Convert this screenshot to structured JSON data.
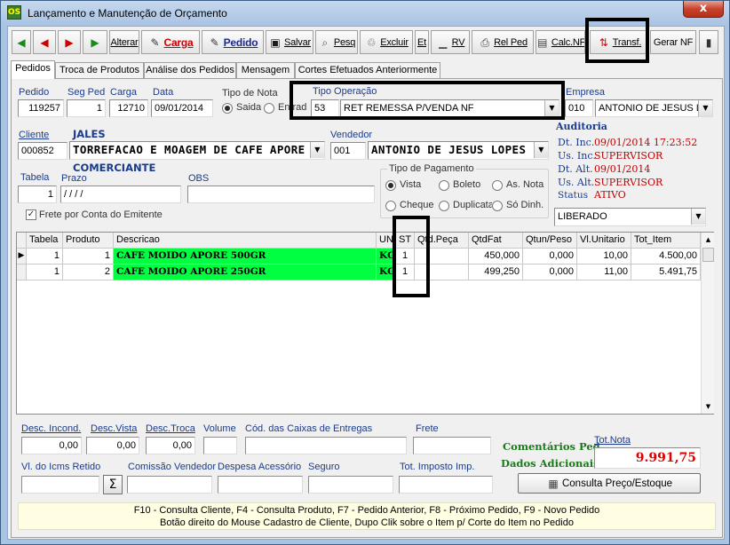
{
  "window": {
    "title": "Lançamento e Manutenção de Orçamento",
    "close_label": "x",
    "icon_label": "OS"
  },
  "toolbar": {
    "alterar": "Alterar",
    "carga_bold": "Carga",
    "pedido_bold": "Pedido",
    "salvar": "Salvar",
    "pesq": "Pesq",
    "excluir": "Excluir",
    "et": "Et",
    "rv": "RV",
    "relped": "Rel Ped",
    "calcnf": "Calc.NF",
    "transf": "Transf.",
    "gerarnf": "Gerar NF"
  },
  "tabs": [
    "Pedidos",
    "Troca de Produtos",
    "Análise dos Pedidos",
    "Mensagem",
    "Cortes Efetuados Anteriormente"
  ],
  "header": {
    "pedido_label": "Pedido",
    "pedido": "119257",
    "segped_label": "Seg Ped",
    "segped": "1",
    "carga_label": "Carga",
    "carga": "12710",
    "data_label": "Data",
    "data": "09/01/2014",
    "tiponota_label": "Tipo de Nota",
    "saida_label": "Saida",
    "entrada_label": "Entrad",
    "tipooperacao_label": "Tipo Operação",
    "tipooperacao_code": "53",
    "tipooperacao_desc": "RET REMESSA P/VENDA NF",
    "empresa_label": "Empresa",
    "empresa_code": "010",
    "empresa_name": "ANTONIO DE JESUS LO",
    "cliente_label": "Cliente",
    "cliente_code": "000852",
    "cliente_city": "JALES",
    "cliente_name": "TORREFACAO E MOAGEM DE CAFE APORE L",
    "cliente_type": "COMERCIANTE",
    "vendedor_label": "Vendedor",
    "vendedor_code": "001",
    "vendedor_name": "ANTONIO DE JESUS LOPES",
    "tabela_label": "Tabela",
    "tabela": "1",
    "prazo_label": "Prazo",
    "prazo": " / / / /",
    "obs_label": "OBS",
    "obs": "",
    "frete_label": "Frete por Conta  do Emitente",
    "tipopag_label": "Tipo de Pagamento",
    "pag_vista": "Vista",
    "pag_boleto": "Boleto",
    "pag_asnota": "As. Nota",
    "pag_cheque": "Cheque",
    "pag_duplicata": "Duplicata",
    "pag_sodinh": "Só Dinh.",
    "status_combo": "LIBERADO"
  },
  "auditoria": {
    "title": "Auditoria",
    "dtinc_label": "Dt. Inc.",
    "dtinc": "09/01/2014 17:23:52",
    "usinc_label": "Us. Inc.",
    "usinc": "SUPERVISOR",
    "dtalt_label": "Dt. Alt.",
    "dtalt": "09/01/2014",
    "usalt_label": "Us. Alt.",
    "usalt": "SUPERVISOR",
    "status_label": "Status",
    "status": "ATIVO"
  },
  "grid": {
    "headers": [
      "Tabela",
      "Produto",
      "Descricao",
      "UN",
      "ST",
      "Qtd.Peça",
      "QtdFat",
      "Qtun/Peso",
      "Vl.Unitario",
      "Tot_Item"
    ],
    "rows": [
      {
        "tabela": "1",
        "produto": "1",
        "descricao": "CAFE MOIDO APORE 500GR",
        "un": "KG",
        "st": "1",
        "qtdpeca": "",
        "qtdfat": "450,000",
        "qtun": "0,000",
        "vlunit": "10,00",
        "tot": "4.500,00"
      },
      {
        "tabela": "1",
        "produto": "2",
        "descricao": "CAFE MOIDO APORE 250GR",
        "un": "KG",
        "st": "1",
        "qtdpeca": "",
        "qtdfat": "499,250",
        "qtun": "0,000",
        "vlunit": "11,00",
        "tot": "5.491,75"
      }
    ]
  },
  "totals": {
    "descincond_label": "Desc. Incond.",
    "descincond": "0,00",
    "descvista_label": "Desc.Vista",
    "descvista": "0,00",
    "desctroca_label": "Desc.Troca",
    "desctroca": "0,00",
    "volume_label": "Volume",
    "volume": "",
    "caixas_label": "Cód. das Caixas de Entregas",
    "caixas": "",
    "frete_label": "Frete",
    "frete": "",
    "comentarios": "Comentários Ped",
    "dados": "Dados Adicionais",
    "totnota_label": "Tot.Nota",
    "totnota": "9.991,75",
    "icms_label": "Vl. do Icms Retido",
    "icms": "",
    "sigma": "Σ",
    "comissao_label": "Comissão Vendedor",
    "comissao": "",
    "despesa_label": "Despesa Acessório",
    "despesa": "",
    "seguro_label": "Seguro",
    "seguro": "",
    "totimp_label": "Tot. Imposto Imp.",
    "totimp": "",
    "consulta_btn": "Consulta Preço/Estoque"
  },
  "footer": {
    "line1": "F10 - Consulta Cliente,   F4 - Consulta Produto,   F7 - Pedido Anterior,   F8 - Próximo Pedido,   F9 - Novo Pedido",
    "line2": "Botão direito do Mouse Cadastro de Cliente,   Dupo Clik sobre o Item p/ Corte do Item no Pedido"
  },
  "colors": {
    "green_highlight": "#00ff40",
    "audit_red": "#c00000",
    "total_red": "#e00000",
    "label_blue": "#1a3b8c"
  }
}
